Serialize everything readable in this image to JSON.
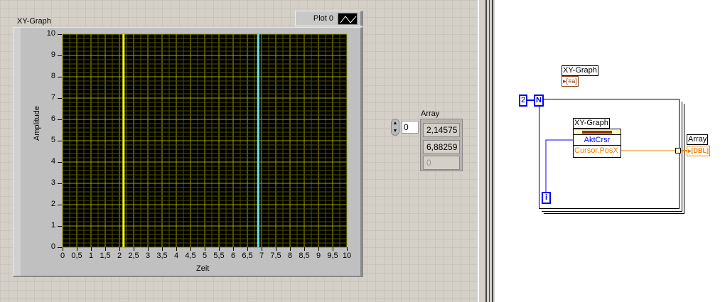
{
  "front_panel": {
    "graph": {
      "label": "XY-Graph",
      "legend_plot": "Plot 0",
      "y_label": "Amplitude",
      "x_label": "Zeit",
      "x_ticks": [
        "0",
        "0,5",
        "1",
        "1,5",
        "2",
        "2,5",
        "3",
        "3,5",
        "4",
        "4,5",
        "5",
        "5,5",
        "6",
        "6,5",
        "7",
        "7,5",
        "8",
        "8,5",
        "9",
        "9,5",
        "10"
      ],
      "y_ticks": [
        "0",
        "1",
        "2",
        "3",
        "4",
        "5",
        "6",
        "7",
        "8",
        "9",
        "10"
      ],
      "xlim": [
        0,
        10
      ],
      "ylim": [
        0,
        10
      ],
      "cursors": [
        {
          "x": 2.14575,
          "color": "#ffff00"
        },
        {
          "x": 6.88259,
          "color": "#66e6ee"
        }
      ],
      "grid_major": "#a0a000",
      "grid_minor": "#505000"
    },
    "array": {
      "label": "Array",
      "index": "0",
      "values": [
        "2,14575",
        "6,88259",
        "0"
      ]
    }
  },
  "block_diagram": {
    "graph_terminal": "XY-Graph",
    "graph_type": "▸[≡a]",
    "loop_count": "2",
    "loop_n": "N",
    "loop_i": "i",
    "property_node": {
      "title": "XY-Graph",
      "items": [
        "AktCrsr",
        "Cursor.PosX"
      ]
    },
    "array_terminal": "Array",
    "array_type": "▸[DBL]"
  }
}
